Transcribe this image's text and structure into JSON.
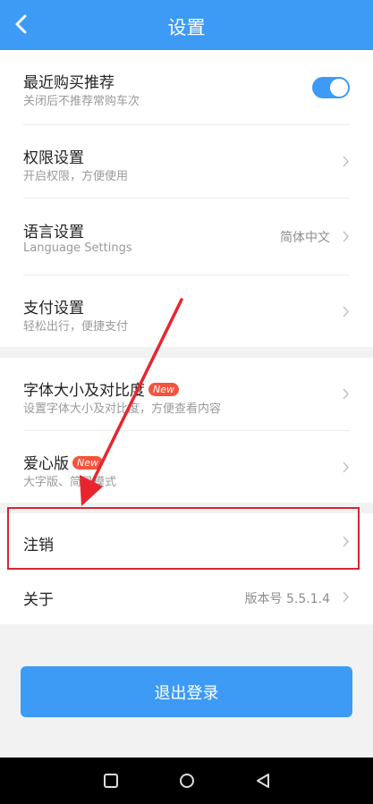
{
  "header": {
    "title": "设置"
  },
  "settings": {
    "recent": {
      "title": "最近购买推荐",
      "subtitle": "关闭后不推荐常购车次"
    },
    "permission": {
      "title": "权限设置",
      "subtitle": "开启权限，方便使用"
    },
    "language": {
      "title": "语言设置",
      "subtitle": "Language Settings",
      "value": "简体中文"
    },
    "payment": {
      "title": "支付设置",
      "subtitle": "轻松出行，便捷支付"
    },
    "font": {
      "title": "字体大小及对比度",
      "badge": "New",
      "subtitle": "设置字体大小及对比度，方便查看内容"
    },
    "elder": {
      "title": "爱心版",
      "badge": "New",
      "subtitle": "大字版、简易模式"
    },
    "cancel": {
      "title": "注销"
    },
    "about": {
      "title": "关于",
      "value": "版本号 5.5.1.4"
    }
  },
  "logout": {
    "label": "退出登录"
  },
  "colors": {
    "accent": "#3d9bf5",
    "badge": "#f5533d",
    "annotation": "#d9252f"
  }
}
